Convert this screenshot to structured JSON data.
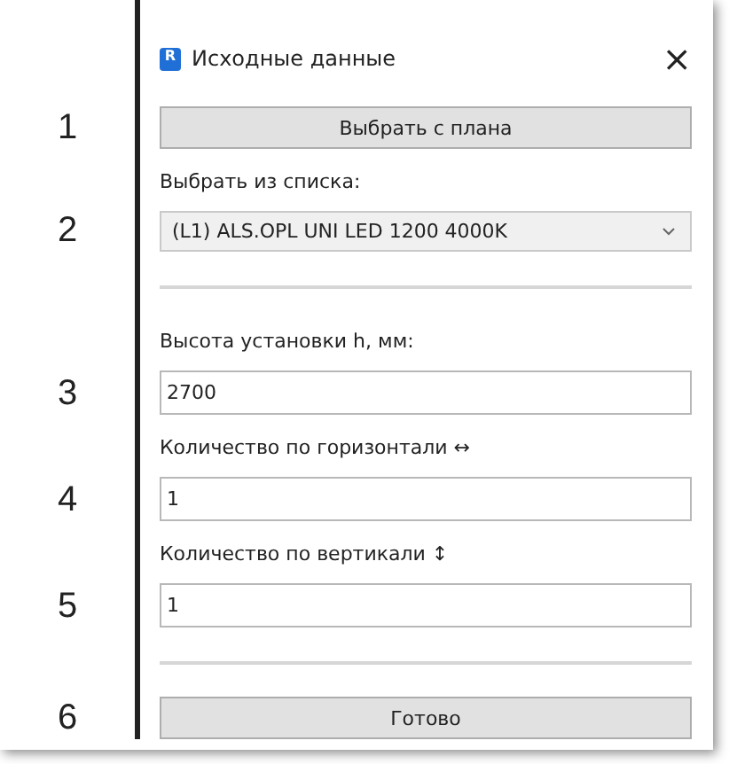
{
  "window": {
    "title": "Исходные данные",
    "icon_letter": "R",
    "close": "×"
  },
  "rows": [
    {
      "kind": "button",
      "marker": "1",
      "label": "Выбрать с плана"
    },
    {
      "kind": "label",
      "text": "Выбрать из списка:"
    },
    {
      "kind": "select",
      "marker": "2",
      "value": "(L1) ALS.OPL UNI LED 1200 4000K"
    },
    {
      "kind": "divider"
    },
    {
      "kind": "label",
      "text": "Высота установки h, мм:"
    },
    {
      "kind": "input",
      "marker": "3",
      "value": "2700"
    },
    {
      "kind": "label",
      "text": "Количество по горизонтали ↔"
    },
    {
      "kind": "input",
      "marker": "4",
      "value": "1"
    },
    {
      "kind": "label",
      "text": "Количество по вертикали ↕"
    },
    {
      "kind": "input",
      "marker": "5",
      "value": "1"
    },
    {
      "kind": "divider"
    },
    {
      "kind": "button",
      "marker": "6",
      "label": "Готово"
    }
  ]
}
